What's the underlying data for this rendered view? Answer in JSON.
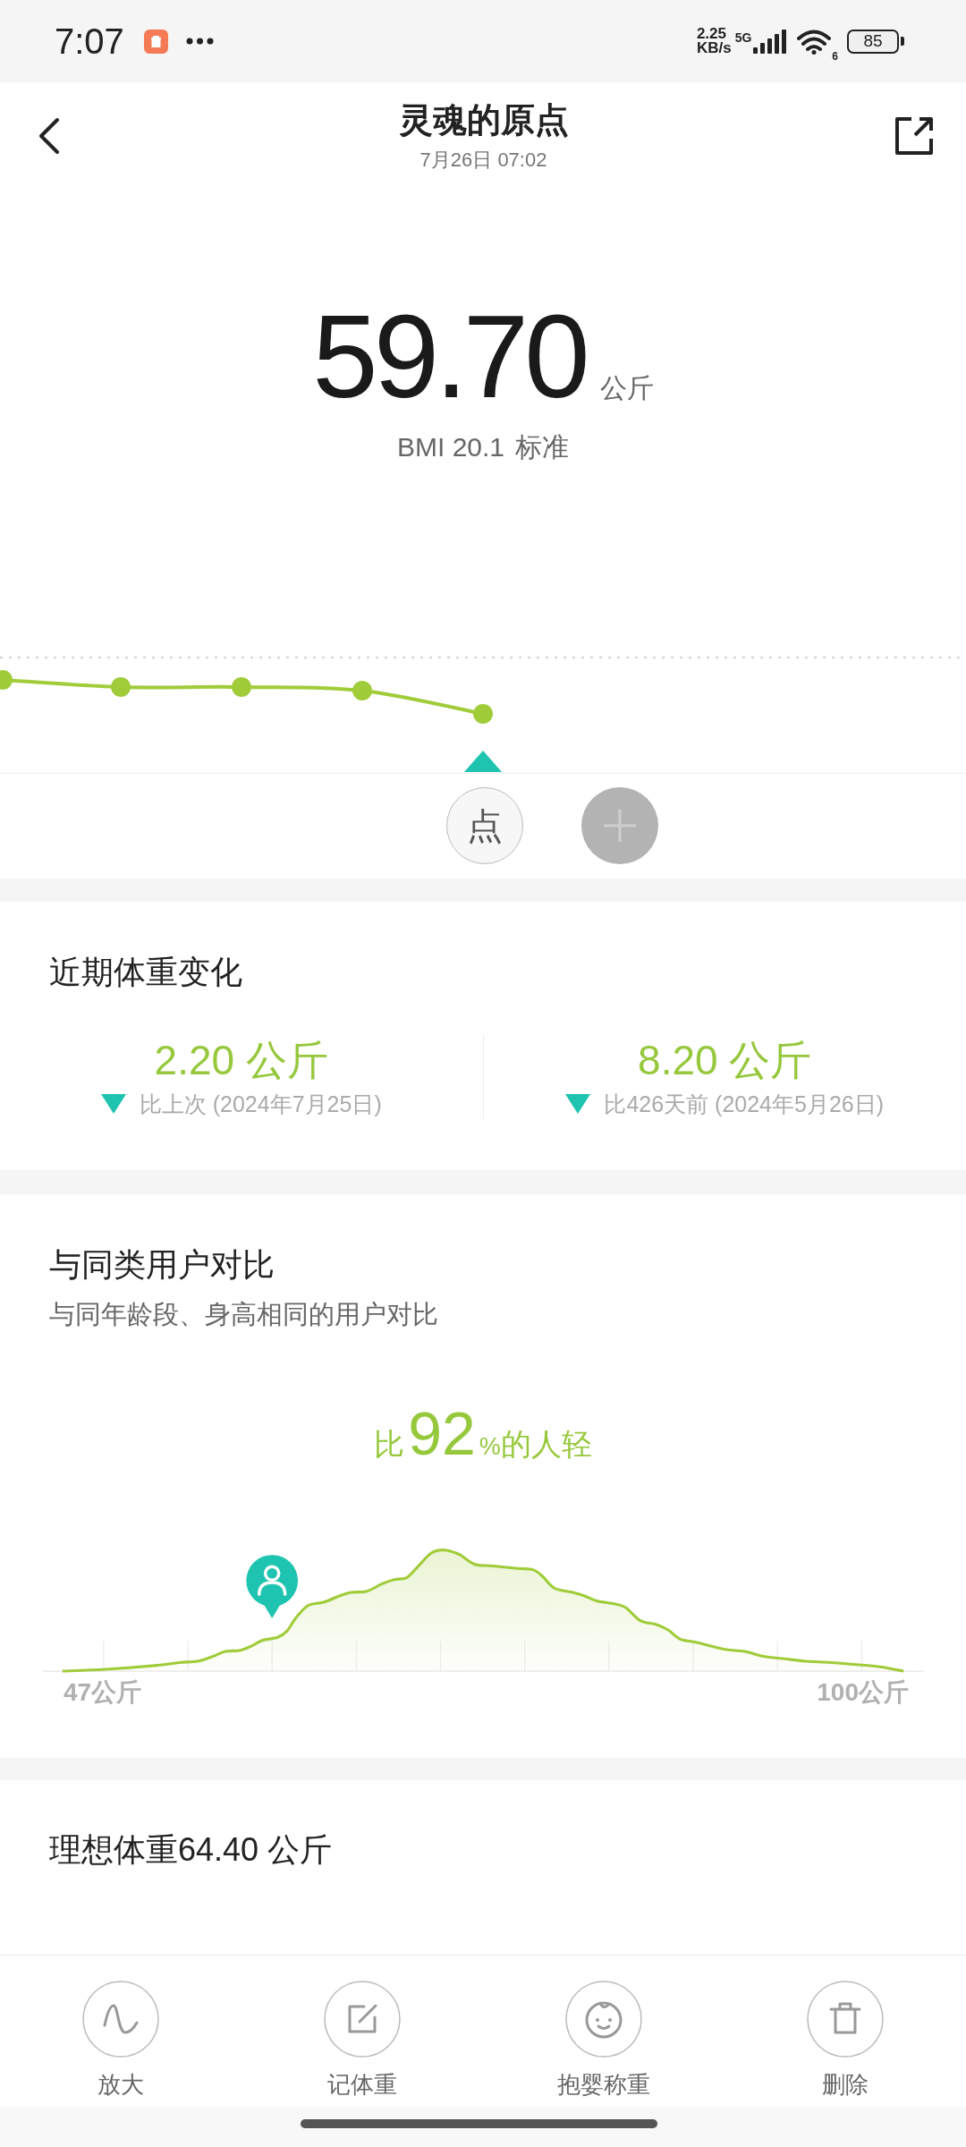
{
  "status_bar": {
    "time": "7:07",
    "net_speed": "2.25",
    "net_speed_unit": "KB/s",
    "network_type": "5G",
    "wifi_label": "6",
    "battery": "85"
  },
  "header": {
    "title": "灵魂的原点",
    "subtitle": "7月26日 07:02"
  },
  "reading": {
    "value": "59.70",
    "unit": "公斤",
    "bmi": "BMI 20.1",
    "bmi_status": "标准"
  },
  "trend_chart": {
    "points": [
      {
        "selected": false
      },
      {
        "selected": false
      },
      {
        "selected": false
      },
      {
        "selected": false
      },
      {
        "selected": true
      }
    ],
    "mode_button": "点"
  },
  "recent_change": {
    "title": "近期体重变化",
    "items": [
      {
        "amount": "2.20 公斤",
        "decreased": true,
        "note": "比上次 (2024年7月25日)"
      },
      {
        "amount": "8.20 公斤",
        "decreased": true,
        "note": "比426天前 (2024年5月26日)"
      }
    ]
  },
  "comparison": {
    "title": "与同类用户对比",
    "subtitle": "与同年龄段、身高相同的用户对比",
    "result": {
      "prefix": "比",
      "value": "92",
      "percent_sign": "%",
      "suffix": "的人轻"
    },
    "x_min_label": "47公斤",
    "x_max_label": "100公斤"
  },
  "ideal_weight": {
    "label": "理想体重64.40 公斤"
  },
  "toolbar": [
    {
      "label": "放大"
    },
    {
      "label": "记体重"
    },
    {
      "label": "抱婴称重"
    },
    {
      "label": "删除"
    }
  ]
}
